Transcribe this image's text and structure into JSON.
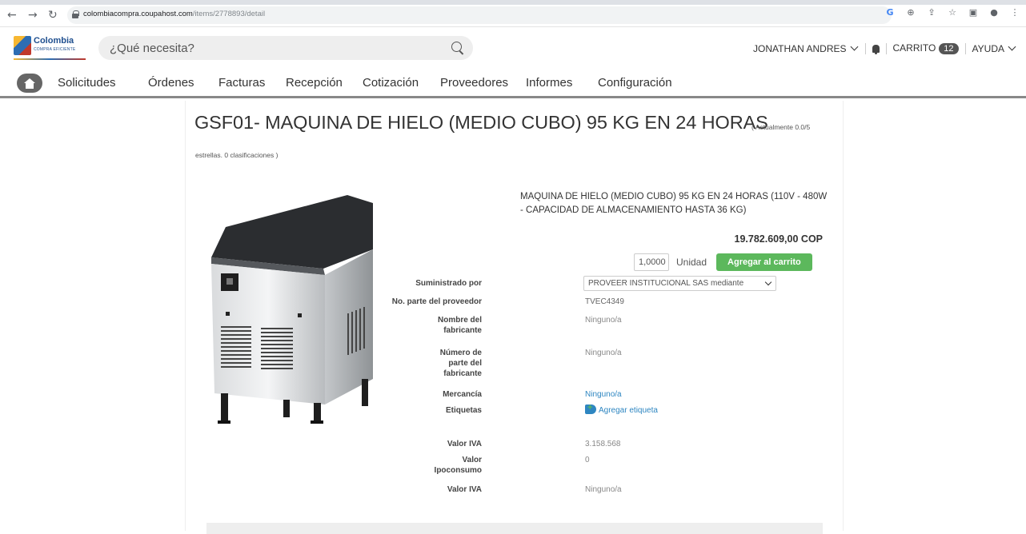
{
  "browser": {
    "url_host": "colombiacompra.coupahost.com",
    "url_path": "/items/2778893/detail",
    "icons": [
      "back-icon",
      "forward-icon",
      "reload-icon",
      "lock-icon",
      "google-icon",
      "zoom-icon",
      "share-icon",
      "star-icon",
      "sidepanel-icon",
      "profile-icon",
      "menu-icon"
    ]
  },
  "header": {
    "logo_text": "Colombia",
    "logo_sub": "COMPRA EFICIENTE",
    "search_placeholder": "¿Qué necesita?",
    "user_name": "JONATHAN ANDRES",
    "cart_label": "CARRITO",
    "cart_count": "12",
    "help_label": "AYUDA"
  },
  "nav": {
    "items": [
      "Solicitudes",
      "Órdenes",
      "Facturas",
      "Recepción",
      "Cotización",
      "Proveedores",
      "Informes",
      "Configuración"
    ]
  },
  "product": {
    "title": "GSF01- MAQUINA DE HIELO (MEDIO CUBO) 95 KG EN 24 HORAS",
    "rating_part1": "( Actualmente 0.0/5",
    "rating_part2": "estrellas. 0 clasificaciones )",
    "description": "MAQUINA DE HIELO (MEDIO CUBO) 95 KG EN 24 HORAS (110V - 480W - CAPACIDAD DE ALMACENAMIENTO HASTA 36 KG)",
    "price": "19.782.609,00 COP",
    "quantity": "1,0000",
    "unit": "Unidad",
    "add_to_cart": "Agregar al carrito"
  },
  "attributes": {
    "supplied_by_label": "Suministrado por",
    "supplied_by_value": "PROVEER INSTITUCIONAL SAS mediante",
    "supplier_part_label": "No. parte del proveedor",
    "supplier_part_value": "TVEC4349",
    "manufacturer_label": "Nombre del fabricante",
    "manufacturer_value": "Ninguno/a",
    "manufacturer_part_label": "Número de parte del fabricante",
    "manufacturer_part_value": "Ninguno/a",
    "commodity_label": "Mercancía",
    "commodity_value": "Ninguno/a",
    "tags_label": "Etiquetas",
    "tags_value": "Agregar etiqueta",
    "iva_label": "Valor IVA",
    "iva_value": "3.158.568",
    "ipoconsumo_label": "Valor Ipoconsumo",
    "ipoconsumo_value": "0",
    "iva2_label": "Valor IVA",
    "iva2_value": "Ninguno/a"
  },
  "colors": {
    "accent_green": "#5cb85c",
    "link_blue": "#2e86c1"
  }
}
